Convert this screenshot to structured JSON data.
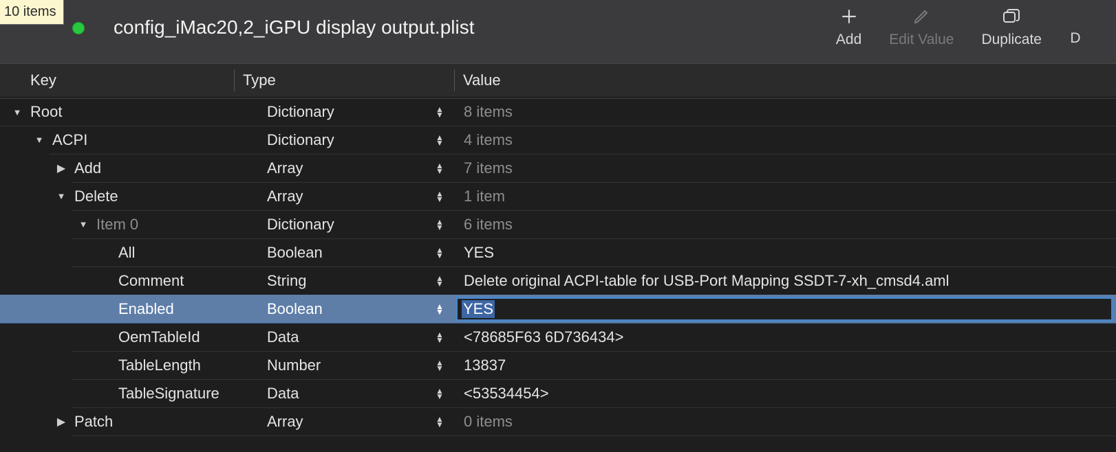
{
  "tooltip": "10 items",
  "window_title": "config_iMac20,2_iGPU display output.plist",
  "toolbar": {
    "add": {
      "label": "Add"
    },
    "edit_value": {
      "label": "Edit Value"
    },
    "duplicate": {
      "label": "Duplicate"
    },
    "partial": {
      "label": "D"
    }
  },
  "columns": {
    "key": "Key",
    "type": "Type",
    "value": "Value"
  },
  "rows": [
    {
      "depth": 1,
      "arrow": "down",
      "key": "Root",
      "key_muted": false,
      "type": "Dictionary",
      "value": "8 items",
      "value_muted": true
    },
    {
      "depth": 2,
      "arrow": "down",
      "key": "ACPI",
      "key_muted": false,
      "type": "Dictionary",
      "value": "4 items",
      "value_muted": true
    },
    {
      "depth": 3,
      "arrow": "right",
      "key": "Add",
      "key_muted": false,
      "type": "Array",
      "value": "7 items",
      "value_muted": true
    },
    {
      "depth": 3,
      "arrow": "down",
      "key": "Delete",
      "key_muted": false,
      "type": "Array",
      "value": "1 item",
      "value_muted": true
    },
    {
      "depth": 4,
      "arrow": "down",
      "key": "Item 0",
      "key_muted": true,
      "type": "Dictionary",
      "value": "6 items",
      "value_muted": true
    },
    {
      "depth": 5,
      "arrow": "none",
      "key": "All",
      "key_muted": false,
      "type": "Boolean",
      "value": "YES",
      "value_muted": false
    },
    {
      "depth": 5,
      "arrow": "none",
      "key": "Comment",
      "key_muted": false,
      "type": "String",
      "value": "Delete original ACPI-table for USB-Port Mapping SSDT-7-xh_cmsd4.aml",
      "value_muted": false
    },
    {
      "depth": 5,
      "arrow": "none",
      "key": "Enabled",
      "key_muted": false,
      "type": "Boolean",
      "value": "YES",
      "value_muted": false,
      "selected": true,
      "editing": true
    },
    {
      "depth": 5,
      "arrow": "none",
      "key": "OemTableId",
      "key_muted": false,
      "type": "Data",
      "value": "<78685F63 6D736434>",
      "value_muted": false
    },
    {
      "depth": 5,
      "arrow": "none",
      "key": "TableLength",
      "key_muted": false,
      "type": "Number",
      "value": "13837",
      "value_muted": false
    },
    {
      "depth": 5,
      "arrow": "none",
      "key": "TableSignature",
      "key_muted": false,
      "type": "Data",
      "value": "<53534454>",
      "value_muted": false
    },
    {
      "depth": 3,
      "arrow": "right",
      "key": "Patch",
      "key_muted": false,
      "type": "Array",
      "value": "0 items",
      "value_muted": true
    }
  ]
}
